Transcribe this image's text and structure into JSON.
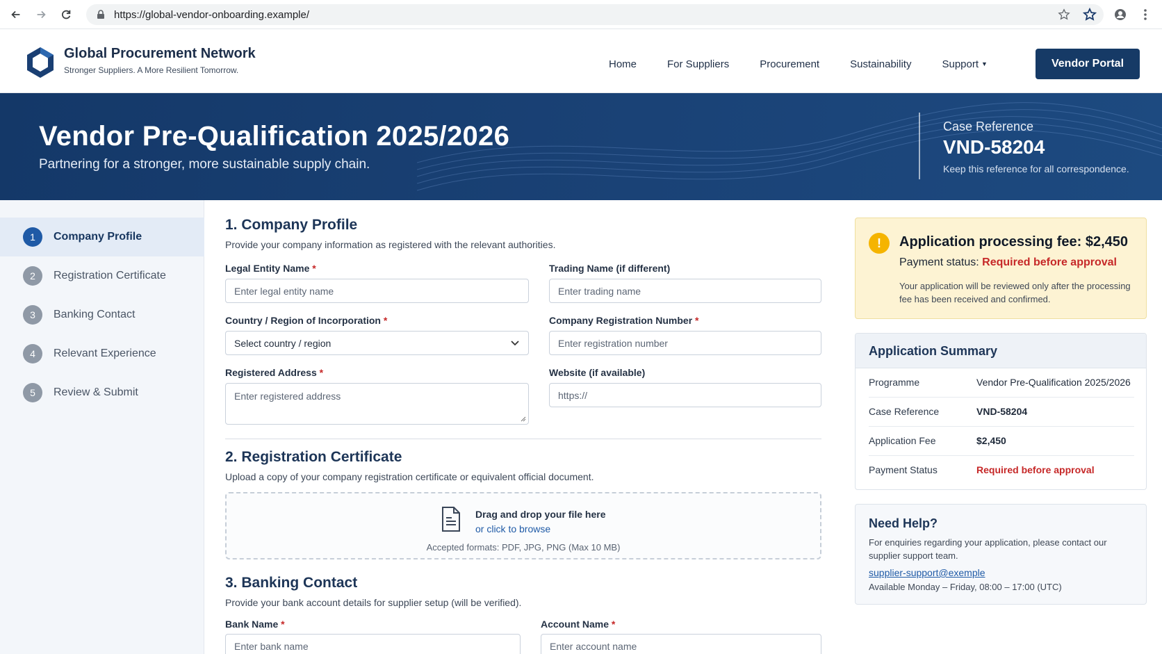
{
  "browser": {
    "url": "https://global-vendor-onboarding.example/"
  },
  "header": {
    "brand_name": "Global Procurement Network",
    "tagline": "Stronger Suppliers. A More Resilient Tomorrow.",
    "nav": [
      "Home",
      "For Suppliers",
      "Procurement",
      "Sustainability",
      "Support"
    ],
    "cta": "Vendor Portal"
  },
  "hero": {
    "title": "Vendor Pre-Qualification 2025/2026",
    "subtitle": "Partnering for a stronger, more sustainable supply chain.",
    "case_label": "Case Reference",
    "case_value": "VND-58204",
    "case_note": "Keep this reference for all correspondence."
  },
  "steps": [
    {
      "num": "1",
      "label": "Company Profile",
      "active": true
    },
    {
      "num": "2",
      "label": "Registration Certificate",
      "active": false
    },
    {
      "num": "3",
      "label": "Banking Contact",
      "active": false
    },
    {
      "num": "4",
      "label": "Relevant Experience",
      "active": false
    },
    {
      "num": "5",
      "label": "Review & Submit",
      "active": false
    }
  ],
  "form": {
    "s1": {
      "title": "1. Company Profile",
      "desc": "Provide your company information as registered with the relevant authorities.",
      "legal_label": "Legal Entity Name",
      "legal_ph": "Enter legal entity name",
      "trading_label": "Trading Name (if different)",
      "trading_ph": "Enter trading name",
      "country_label": "Country / Region of Incorporation",
      "country_value": "Select country / region",
      "regnum_label": "Company Registration Number",
      "regnum_ph": "Enter registration number",
      "address_label": "Registered Address",
      "address_ph": "Enter registered address",
      "website_label": "Website (if available)",
      "website_ph": "https://"
    },
    "s2": {
      "title": "2. Registration Certificate",
      "desc": "Upload a copy of your company registration certificate or equivalent official document.",
      "drop_main": "Drag and drop your file here",
      "drop_link": "or click to browse",
      "drop_note": "Accepted formats: PDF, JPG, PNG (Max 10 MB)"
    },
    "s3": {
      "title": "3. Banking Contact",
      "desc": "Provide your bank account details for supplier setup (will be verified).",
      "bank_label": "Bank Name",
      "bank_ph": "Enter bank name",
      "account_label": "Account Name",
      "account_ph": "Enter account name"
    },
    "required_mark": "*"
  },
  "fee": {
    "icon": "!",
    "title": "Application processing fee: $2,450",
    "status_label": "Payment status:",
    "status_value": "Required before approval",
    "note": "Your application will be reviewed only after the processing fee has been received and confirmed."
  },
  "summary": {
    "title": "Application Summary",
    "rows": [
      {
        "k": "Programme",
        "v": "Vendor Pre-Qualification 2025/2026"
      },
      {
        "k": "Case Reference",
        "v": "VND-58204"
      },
      {
        "k": "Application Fee",
        "v": "$2,450"
      },
      {
        "k": "Payment Status",
        "v": "Required before approval"
      }
    ]
  },
  "help": {
    "title": "Need Help?",
    "text": "For enquiries regarding your application, please contact our supplier support team.",
    "email": "supplier-support@exemple",
    "hours": "Available Monday – Friday, 08:00 – 17:00 (UTC)"
  },
  "colors": {
    "primary": "#163a66",
    "accent": "#1f5aa6",
    "danger": "#c62828",
    "warning_bg": "#fdf3d3",
    "warning_icon": "#f5b400"
  }
}
